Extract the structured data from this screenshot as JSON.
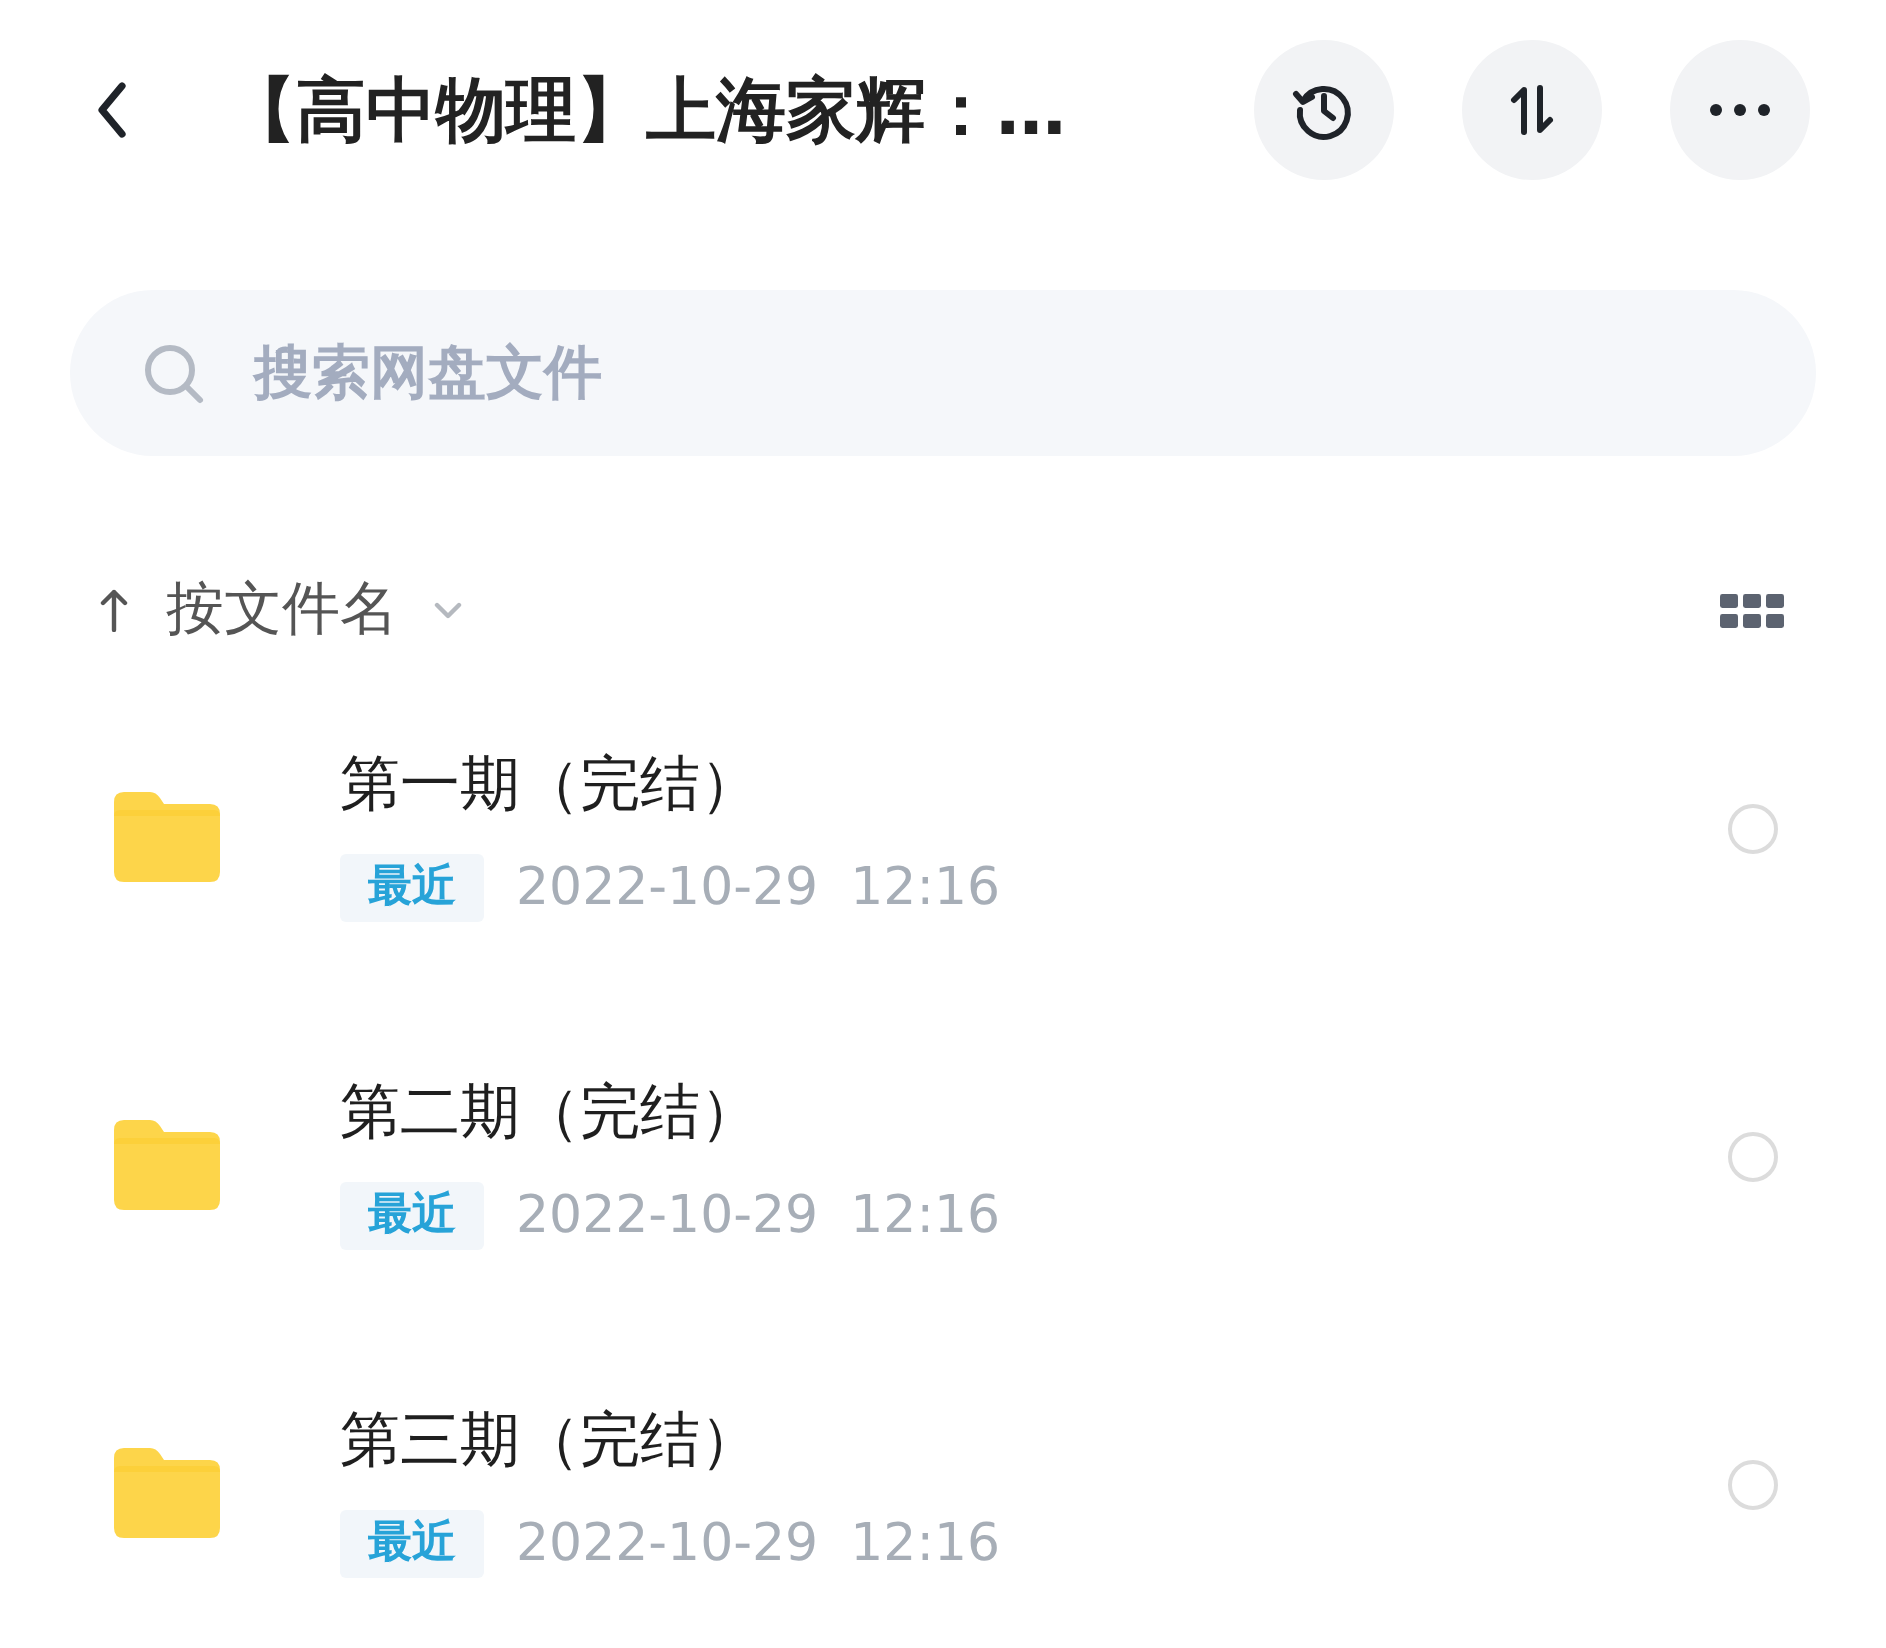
{
  "header": {
    "title": "【高中物理】上海家辉：…"
  },
  "search": {
    "placeholder": "搜索网盘文件"
  },
  "sort": {
    "label": "按文件名"
  },
  "files": [
    {
      "name": "第一期（完结）",
      "badge": "最近",
      "date": "2022-10-29",
      "time": "12:16",
      "selected": false
    },
    {
      "name": "第二期（完结）",
      "badge": "最近",
      "date": "2022-10-29",
      "time": "12:16",
      "selected": false
    },
    {
      "name": "第三期（完结）",
      "badge": "最近",
      "date": "2022-10-29",
      "time": "12:16",
      "selected": false
    }
  ]
}
